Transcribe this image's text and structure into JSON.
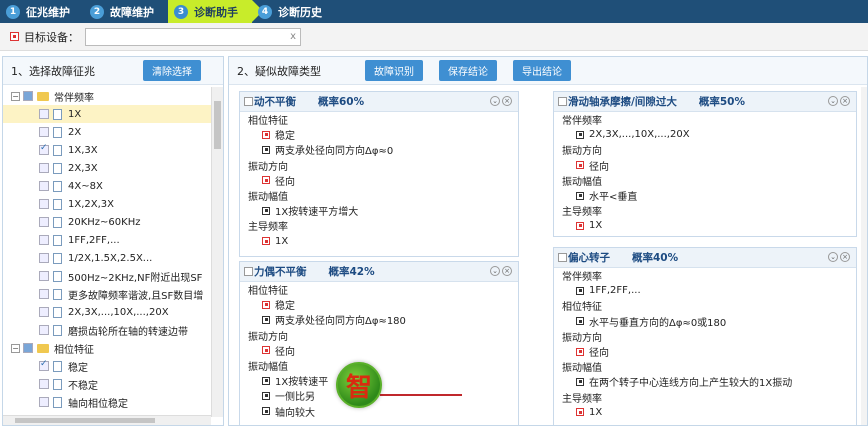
{
  "steps": [
    {
      "num": "1",
      "label": "征兆维护"
    },
    {
      "num": "2",
      "label": "故障维护"
    },
    {
      "num": "3",
      "label": "诊断助手"
    },
    {
      "num": "4",
      "label": "诊断历史"
    }
  ],
  "filter": {
    "label": "目标设备：",
    "value": "",
    "clear": "x"
  },
  "left": {
    "title": "1、选择故障征兆",
    "clear_button": "清除选择",
    "tree": [
      {
        "type": "group",
        "label": "常伴频率"
      },
      {
        "type": "leaf",
        "label": "1X",
        "checked": false,
        "selected": true
      },
      {
        "type": "leaf",
        "label": "2X",
        "checked": false
      },
      {
        "type": "leaf",
        "label": "1X,3X",
        "checked": true
      },
      {
        "type": "leaf",
        "label": "2X,3X",
        "checked": false
      },
      {
        "type": "leaf",
        "label": "4X~8X",
        "checked": false
      },
      {
        "type": "leaf",
        "label": "1X,2X,3X",
        "checked": false
      },
      {
        "type": "leaf",
        "label": "20KHz~60KHz",
        "checked": false
      },
      {
        "type": "leaf",
        "label": "1FF,2FF,...",
        "checked": false
      },
      {
        "type": "leaf",
        "label": "1/2X,1.5X,2.5X...",
        "checked": false
      },
      {
        "type": "leaf",
        "label": "500Hz~2KHz,NF附近出现SF",
        "checked": false
      },
      {
        "type": "leaf",
        "label": "更多故障频率谐波,且SF数目增",
        "checked": false
      },
      {
        "type": "leaf",
        "label": "2X,3X,...,10X,...,20X",
        "checked": false
      },
      {
        "type": "leaf",
        "label": "磨损齿轮所在轴的转速边带",
        "checked": false
      },
      {
        "type": "group",
        "label": "相位特征"
      },
      {
        "type": "leaf",
        "label": "稳定",
        "checked": true
      },
      {
        "type": "leaf",
        "label": "不稳定",
        "checked": false
      },
      {
        "type": "leaf",
        "label": "轴向相位稳定",
        "checked": false
      }
    ]
  },
  "right": {
    "title": "2、疑似故障类型",
    "buttons": [
      "故障识别",
      "保存结论",
      "导出结论"
    ],
    "cards": [
      {
        "name": "动不平衡",
        "prob": "概率60%",
        "lines": [
          {
            "t": "相位特征",
            "l": 0
          },
          {
            "t": "稳定",
            "l": 1,
            "red": true
          },
          {
            "t": "两支承处径向同方向Δφ≈0",
            "l": 1
          },
          {
            "t": "振动方向",
            "l": 0
          },
          {
            "t": "径向",
            "l": 1,
            "red": true
          },
          {
            "t": "振动幅值",
            "l": 0
          },
          {
            "t": "1X按转速平方增大",
            "l": 1
          },
          {
            "t": "主导频率",
            "l": 0
          },
          {
            "t": "1X",
            "l": 1,
            "red": true
          }
        ]
      },
      {
        "name": "力偶不平衡",
        "prob": "概率42%",
        "lines": [
          {
            "t": "相位特征",
            "l": 0
          },
          {
            "t": "稳定",
            "l": 1,
            "red": true
          },
          {
            "t": "两支承处径向同方向Δφ≈180",
            "l": 1
          },
          {
            "t": "振动方向",
            "l": 0
          },
          {
            "t": "径向",
            "l": 1,
            "red": true
          },
          {
            "t": "振动幅值",
            "l": 0
          },
          {
            "t": "1X按转速平",
            "l": 1
          },
          {
            "t": "一侧比另",
            "l": 1
          },
          {
            "t": "轴向较大",
            "l": 1
          }
        ]
      },
      {
        "name": "滑动轴承摩擦/间隙过大",
        "prob": "概率50%",
        "lines": [
          {
            "t": "常伴频率",
            "l": 0
          },
          {
            "t": "2X,3X,...,10X,...,20X",
            "l": 1
          },
          {
            "t": "振动方向",
            "l": 0
          },
          {
            "t": "径向",
            "l": 1,
            "red": true
          },
          {
            "t": "振动幅值",
            "l": 0
          },
          {
            "t": "水平<垂直",
            "l": 1
          },
          {
            "t": "主导频率",
            "l": 0
          },
          {
            "t": "1X",
            "l": 1,
            "red": true
          }
        ]
      },
      {
        "name": "偏心转子",
        "prob": "概率40%",
        "lines": [
          {
            "t": "常伴频率",
            "l": 0
          },
          {
            "t": "1FF,2FF,...",
            "l": 1
          },
          {
            "t": "相位特征",
            "l": 0
          },
          {
            "t": "水平与垂直方向的Δφ≈0或180",
            "l": 1
          },
          {
            "t": "振动方向",
            "l": 0
          },
          {
            "t": "径向",
            "l": 1,
            "red": true
          },
          {
            "t": "振动幅值",
            "l": 0
          },
          {
            "t": "在两个转子中心连线方向上产生较大的1X振动",
            "l": 1
          },
          {
            "t": "主导频率",
            "l": 0
          },
          {
            "t": "1X",
            "l": 1,
            "red": true
          }
        ]
      }
    ]
  },
  "logo": {
    "char": "智"
  }
}
